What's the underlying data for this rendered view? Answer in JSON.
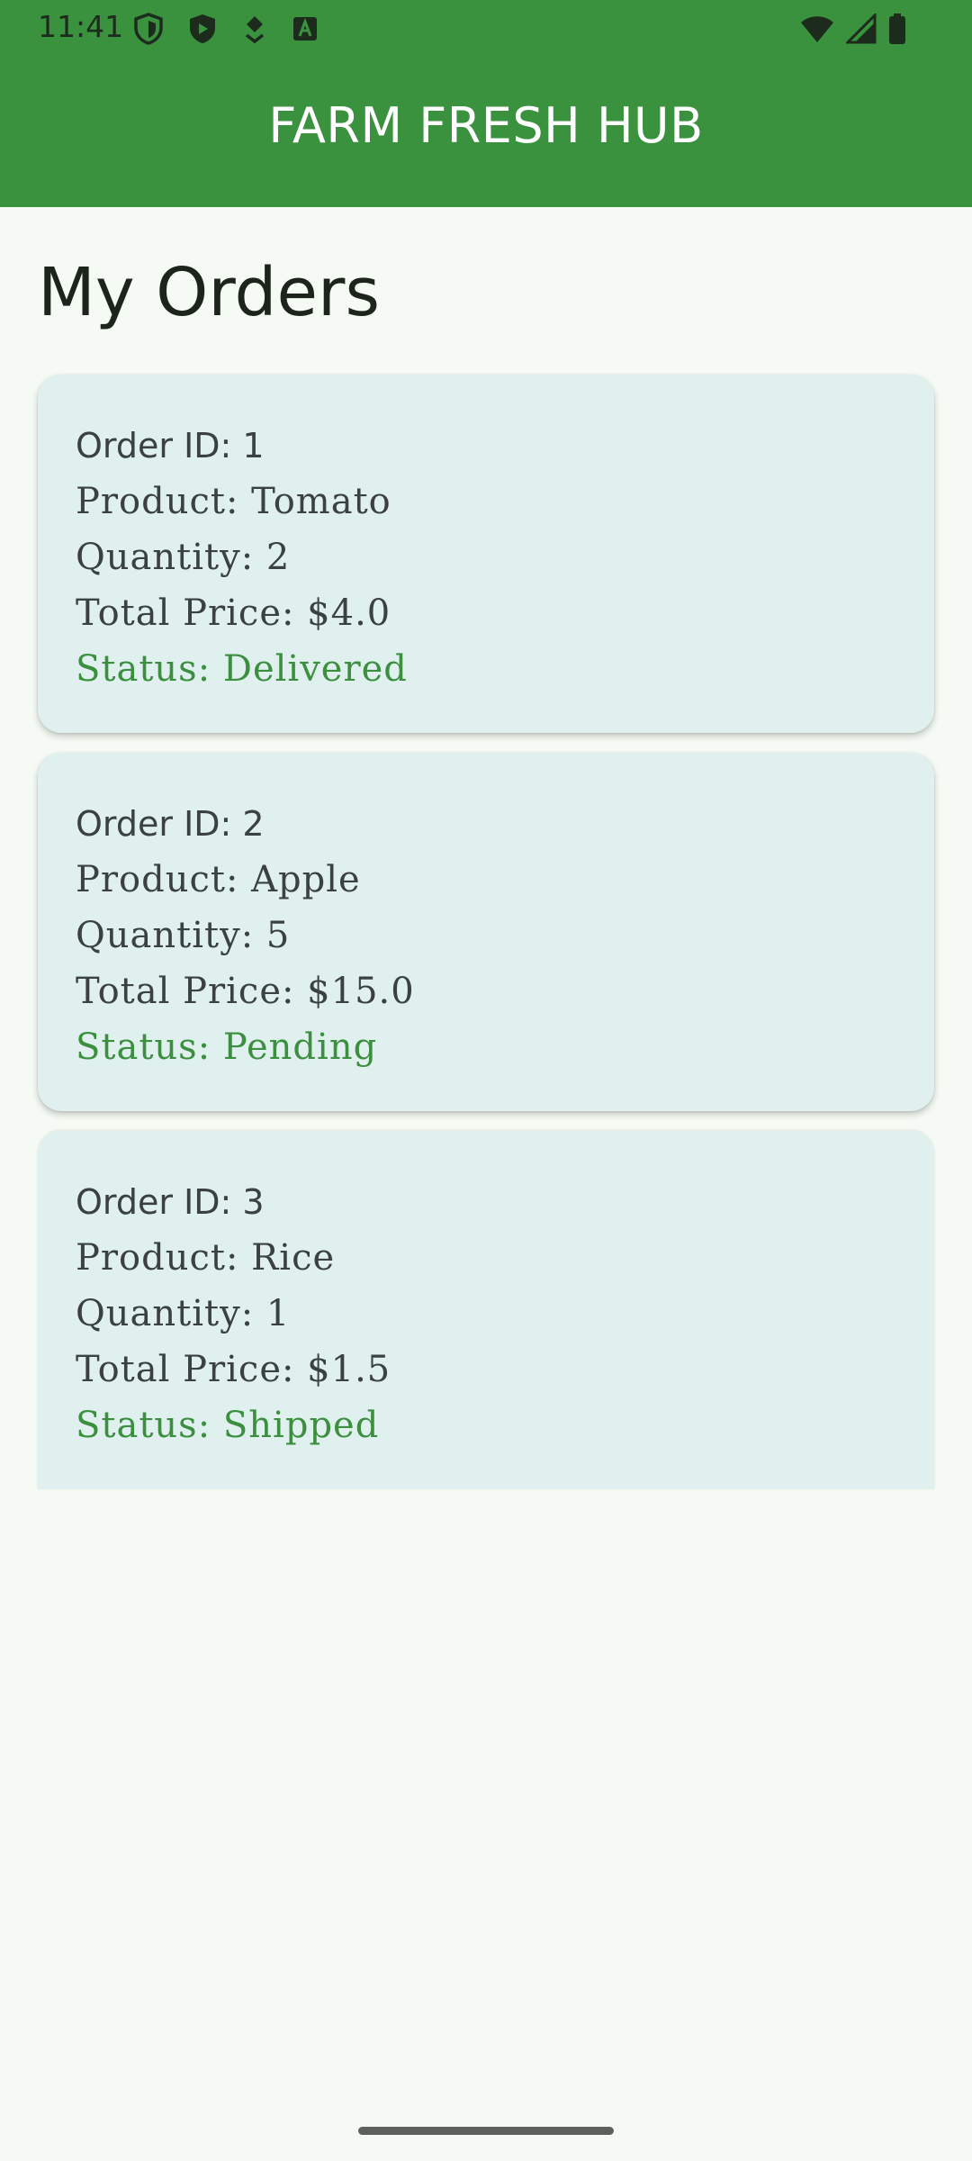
{
  "status_bar": {
    "time": "11:41",
    "left_icons": [
      "vpn-shield-icon",
      "play-protect-icon",
      "download-icon",
      "font-a-icon"
    ],
    "right_icons": [
      "wifi-icon",
      "signal-icon",
      "battery-icon"
    ]
  },
  "app_bar": {
    "title": "FARM FRESH HUB",
    "background": "#3a913e"
  },
  "page": {
    "title": "My Orders"
  },
  "orders": [
    {
      "order_id": "Order ID: 1",
      "product": "Product: Tomato",
      "quantity": "Quantity: 2",
      "total_price": "Total Price: $4.0",
      "status": "Status: Delivered"
    },
    {
      "order_id": "Order ID: 2",
      "product": "Product: Apple",
      "quantity": "Quantity: 5",
      "total_price": "Total Price: $15.0",
      "status": "Status: Pending"
    },
    {
      "order_id": "Order ID: 3",
      "product": "Product: Rice",
      "quantity": "Quantity: 1",
      "total_price": "Total Price: $1.5",
      "status": "Status: Shipped"
    }
  ],
  "colors": {
    "accent": "#3a913e",
    "status_text": "#3b8f3f",
    "card_background": "#dff0ef",
    "page_background": "#f5fbf4"
  }
}
